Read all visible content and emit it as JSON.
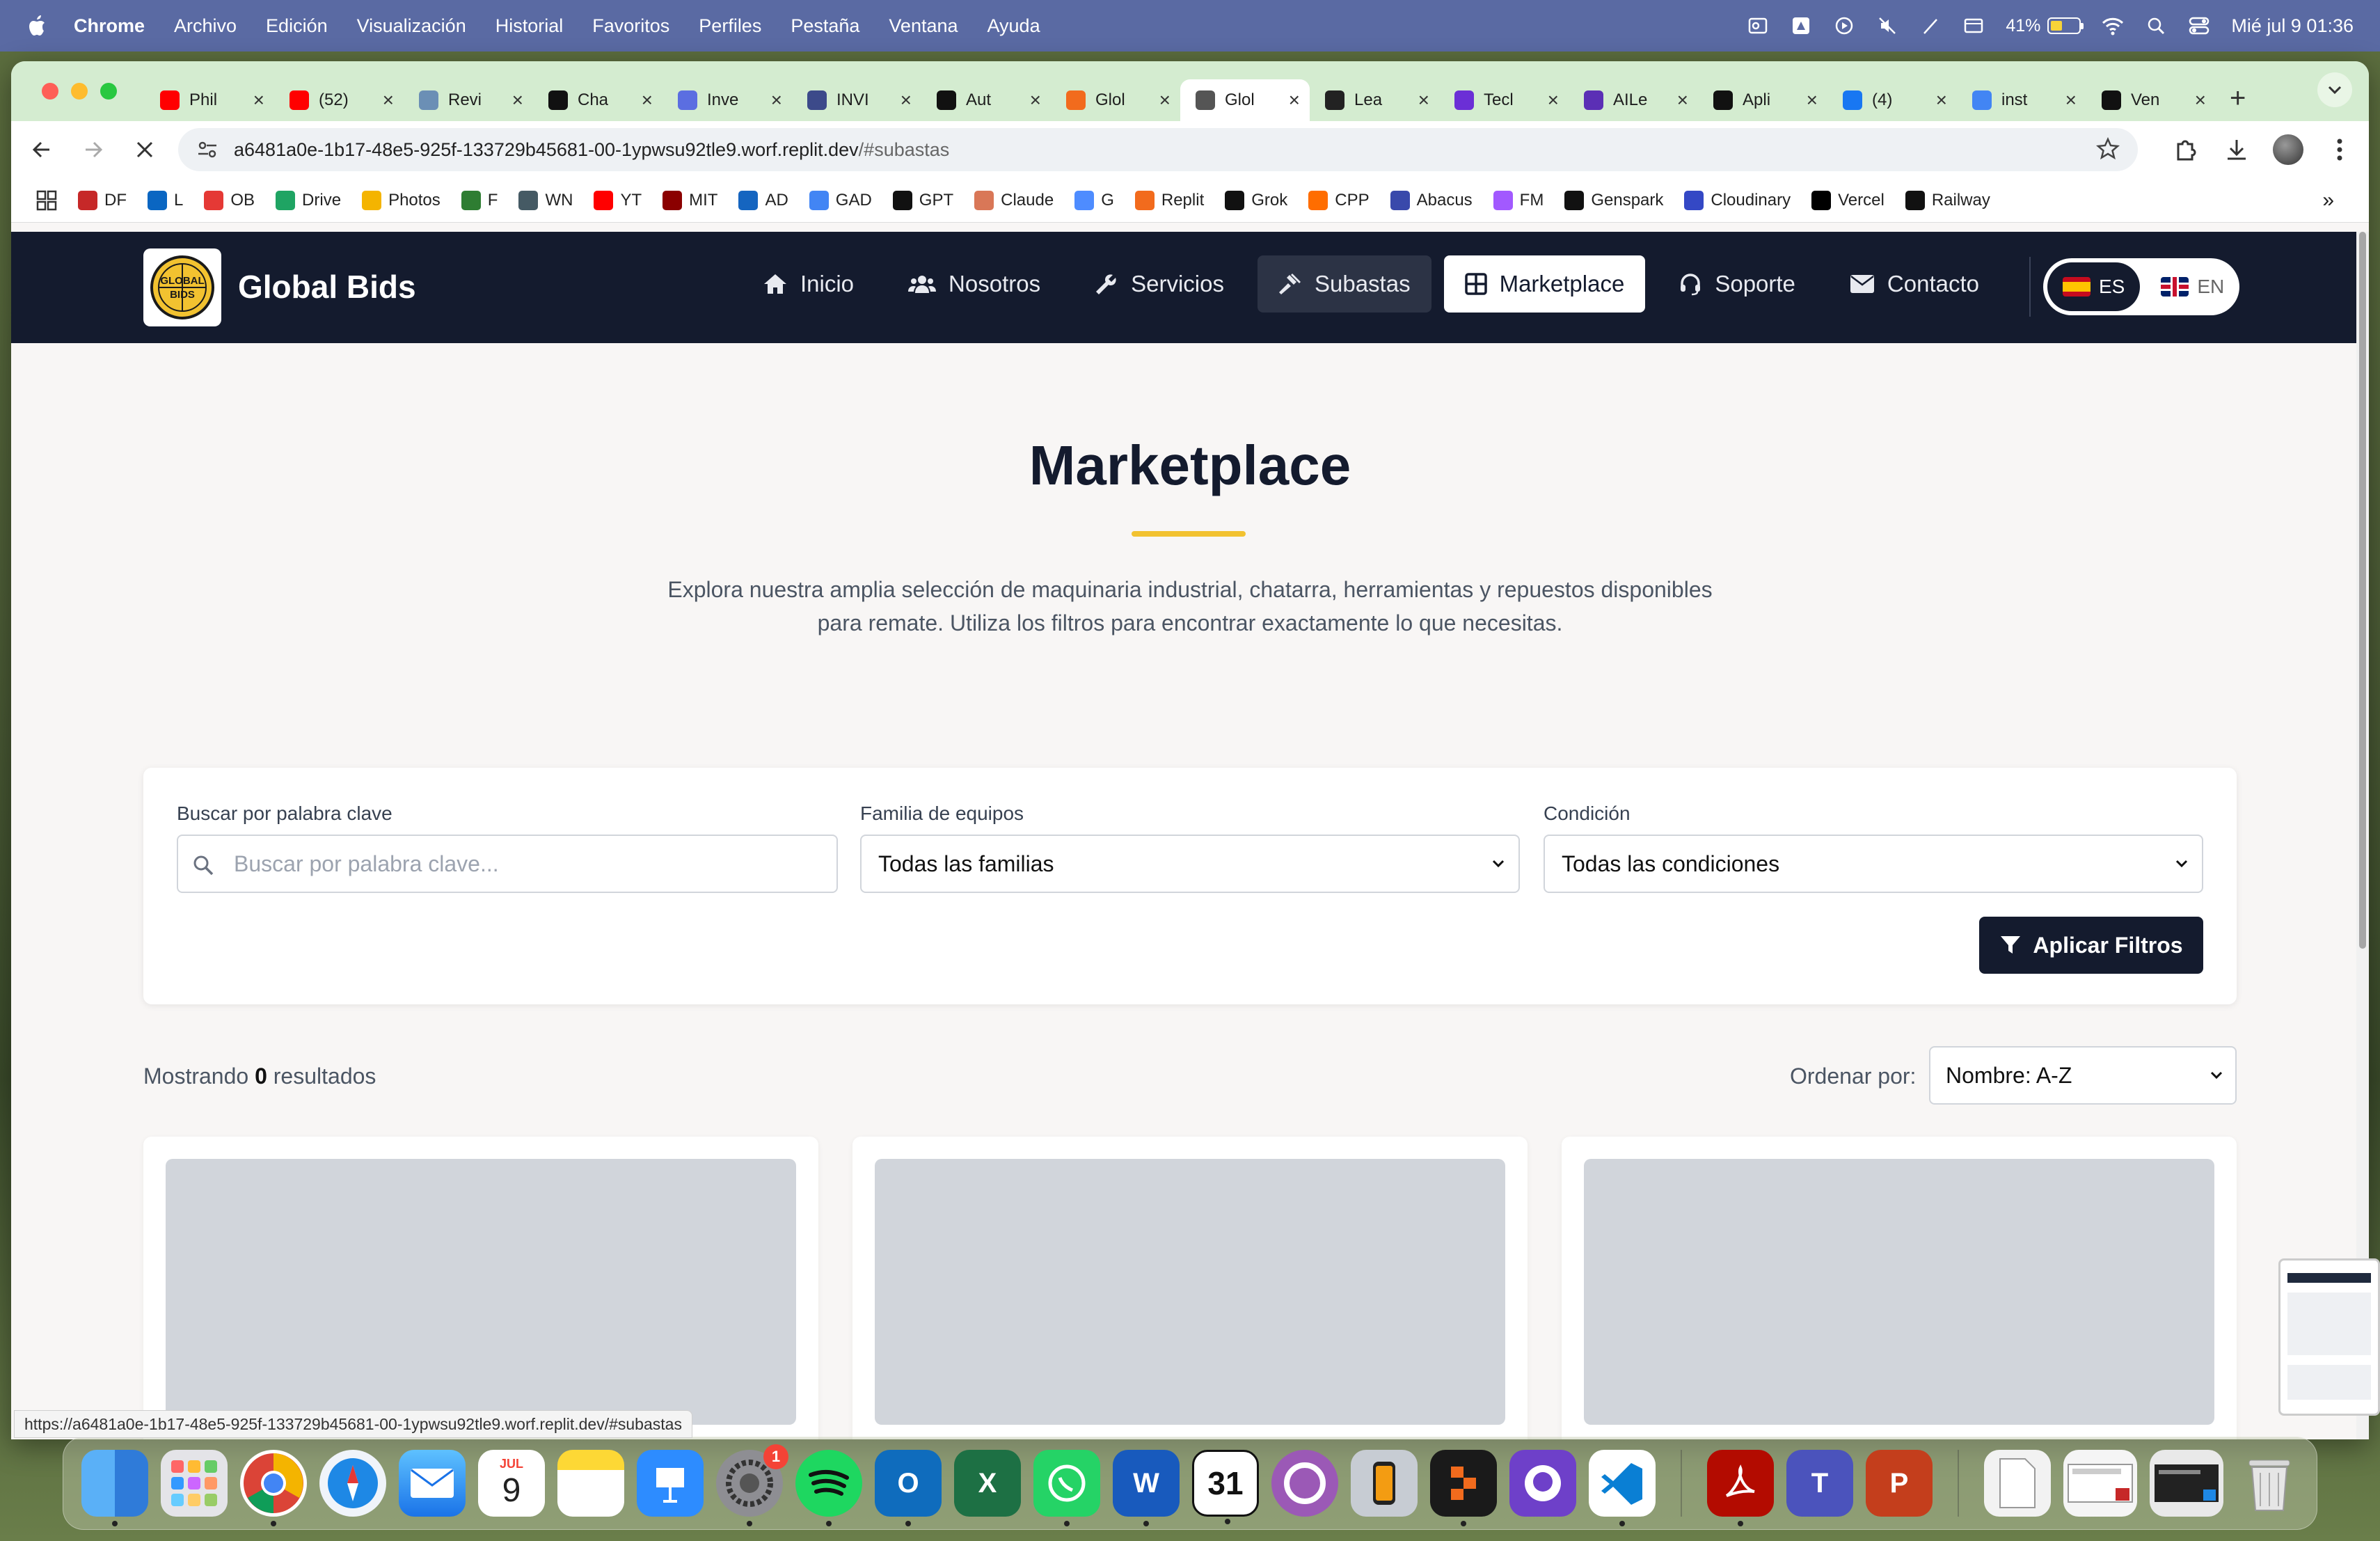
{
  "menubar": {
    "app": "Chrome",
    "items": [
      "Archivo",
      "Edición",
      "Visualización",
      "Historial",
      "Favoritos",
      "Perfiles",
      "Pestaña",
      "Ventana",
      "Ayuda"
    ],
    "battery": "41%",
    "datetime": "Mié jul 9  01:36"
  },
  "tabs": [
    {
      "title": "Phil",
      "color": "#ff0000"
    },
    {
      "title": "(52)",
      "color": "#ff0000"
    },
    {
      "title": "Revi",
      "color": "#6b8fb5"
    },
    {
      "title": "Cha",
      "color": "#111111"
    },
    {
      "title": "Inve",
      "color": "#5b6ee1"
    },
    {
      "title": "INVI",
      "color": "#3c4a8a"
    },
    {
      "title": "Aut",
      "color": "#111111"
    },
    {
      "title": "Glol",
      "color": "#f26b1d"
    },
    {
      "title": "Glol",
      "color": "#555555"
    },
    {
      "title": "Lea",
      "color": "#222222"
    },
    {
      "title": "Tecl",
      "color": "#6b2fd6"
    },
    {
      "title": "AILe",
      "color": "#5b2fb5"
    },
    {
      "title": "Apli",
      "color": "#111111"
    },
    {
      "title": "(4)",
      "color": "#1877f2"
    },
    {
      "title": "inst",
      "color": "#4285f4"
    },
    {
      "title": "Ven",
      "color": "#111111"
    }
  ],
  "active_tab_index": 8,
  "omnibox": {
    "url_main": "a6481a0e-1b17-48e5-925f-133729b45681-00-1ypwsu92tle9.worf.replit.dev",
    "url_hash": "/#subastas"
  },
  "bookmarks": [
    {
      "label": "DF",
      "color": "#c62828"
    },
    {
      "label": "L",
      "color": "#0a66c2"
    },
    {
      "label": "OB",
      "color": "#e53935"
    },
    {
      "label": "Drive",
      "color": "#1fa463"
    },
    {
      "label": "Photos",
      "color": "#f4b400"
    },
    {
      "label": "F",
      "color": "#2e7d32"
    },
    {
      "label": "WN",
      "color": "#455a64"
    },
    {
      "label": "YT",
      "color": "#ff0000"
    },
    {
      "label": "MIT",
      "color": "#8b0000"
    },
    {
      "label": "AD",
      "color": "#1565c0"
    },
    {
      "label": "GAD",
      "color": "#4285f4"
    },
    {
      "label": "GPT",
      "color": "#111111"
    },
    {
      "label": "Claude",
      "color": "#d97757"
    },
    {
      "label": "G",
      "color": "#4e8cff"
    },
    {
      "label": "Replit",
      "color": "#f26b1d"
    },
    {
      "label": "Grok",
      "color": "#111111"
    },
    {
      "label": "CPP",
      "color": "#ff6d00"
    },
    {
      "label": "Abacus",
      "color": "#3949ab"
    },
    {
      "label": "FM",
      "color": "#a259ff"
    },
    {
      "label": "Genspark",
      "color": "#111111"
    },
    {
      "label": "Cloudinary",
      "color": "#3448c5"
    },
    {
      "label": "Vercel",
      "color": "#000000"
    },
    {
      "label": "Railway",
      "color": "#111111"
    }
  ],
  "site": {
    "brand": "Global Bids",
    "logo_text": "GLOBAL BIDS",
    "nav": [
      {
        "label": "Inicio",
        "icon": "home-icon"
      },
      {
        "label": "Nosotros",
        "icon": "users-icon"
      },
      {
        "label": "Servicios",
        "icon": "wrench-icon"
      },
      {
        "label": "Subastas",
        "icon": "gavel-icon"
      },
      {
        "label": "Marketplace",
        "icon": "grid-icon"
      },
      {
        "label": "Soporte",
        "icon": "headset-icon"
      },
      {
        "label": "Contacto",
        "icon": "envelope-icon"
      }
    ],
    "lang_es": "ES",
    "lang_en": "EN",
    "colors": {
      "header": "#141b2e",
      "accent": "#f2c230"
    }
  },
  "hero": {
    "title": "Marketplace",
    "desc_line1": "Explora nuestra amplia selección de maquinaria industrial, chatarra, herramientas y repuestos disponibles",
    "desc_line2": "para remate. Utiliza los filtros para encontrar exactamente lo que necesitas."
  },
  "filters": {
    "search_label": "Buscar por palabra clave",
    "search_placeholder": "Buscar por palabra clave...",
    "family_label": "Familia de equipos",
    "family_value": "Todas las familias",
    "condition_label": "Condición",
    "condition_value": "Todas las condiciones",
    "apply_label": "Aplicar Filtros"
  },
  "results": {
    "prefix": "Mostrando",
    "count": "0",
    "suffix": "resultados",
    "sort_label": "Ordenar por:",
    "sort_value": "Nombre: A-Z"
  },
  "status_url": "https://a6481a0e-1b17-48e5-925f-133729b45681-00-1ypwsu92tle9.worf.replit.dev/#subastas",
  "dock": {
    "calendar_month": "JUL",
    "calendar_day": "9",
    "settings_badge": "1",
    "day31": "31"
  }
}
